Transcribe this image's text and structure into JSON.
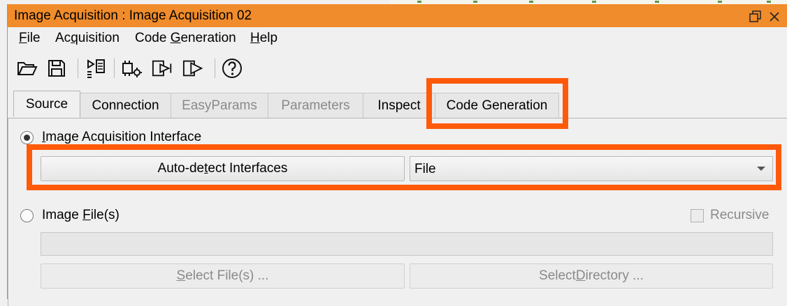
{
  "window": {
    "title": "Image Acquisition : Image Acquisition 02"
  },
  "menu": [
    {
      "pre": "",
      "ul": "F",
      "post": "ile"
    },
    {
      "pre": "Ac",
      "ul": "q",
      "post": "uisition"
    },
    {
      "pre": "Code ",
      "ul": "G",
      "post": "eneration"
    },
    {
      "pre": "",
      "ul": "H",
      "post": "elp"
    }
  ],
  "toolbar": [
    "open-folder-icon",
    "save-icon",
    "detect-icon",
    "settings-chip-icon",
    "snap-icon",
    "live-icon",
    "help-icon"
  ],
  "tabs": [
    {
      "label": "Source",
      "state": "active"
    },
    {
      "label": "Connection",
      "state": "normal"
    },
    {
      "label": "EasyParams",
      "state": "disabled"
    },
    {
      "label": "Parameters",
      "state": "disabled"
    },
    {
      "label": "Inspect",
      "state": "normal"
    },
    {
      "label": "Code Generation",
      "state": "normal"
    }
  ],
  "source": {
    "interface_radio": {
      "pre": "",
      "ul": "I",
      "post": "mage Acquisition Interface",
      "checked": true
    },
    "autodetect_button": {
      "pre": "Auto-de",
      "ul": "t",
      "post": "ect Interfaces"
    },
    "interface_combo": {
      "value": "File"
    },
    "file_radio": {
      "pre": "Image ",
      "ul": "F",
      "post": "ile(s)",
      "checked": false
    },
    "recursive": {
      "label": "Recursive",
      "checked": false
    },
    "file_path": {
      "value": ""
    },
    "select_files": {
      "pre": "",
      "ul": "S",
      "post": "elect File(s) ..."
    },
    "select_directory": {
      "pre": "Select ",
      "ul": "D",
      "post": "irectory ..."
    }
  },
  "colors": {
    "titlebar": "#f08c2b",
    "highlight": "#ff5a0a"
  }
}
